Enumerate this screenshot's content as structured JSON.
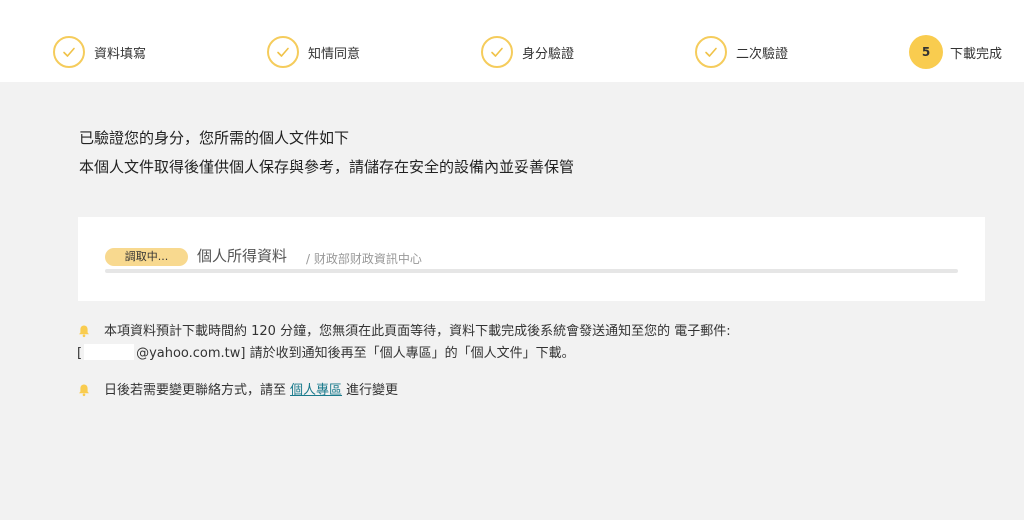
{
  "steps": [
    {
      "label": "資料填寫",
      "status": "done"
    },
    {
      "label": "知情同意",
      "status": "done"
    },
    {
      "label": "身分驗證",
      "status": "done"
    },
    {
      "label": "二次驗證",
      "status": "done"
    },
    {
      "label": "下載完成",
      "status": "active",
      "number": "5"
    }
  ],
  "intro": {
    "line1": "已驗證您的身分，您所需的個人文件如下",
    "line2": "本個人文件取得後僅供個人保存與參考，請儲存在安全的設備內並妥善保管"
  },
  "document": {
    "status_badge": "調取中...",
    "name": "個人所得資料",
    "source": "/ 财政部财政資訊中心",
    "progress": 0
  },
  "notices": {
    "download": {
      "line1": "本項資料預計下載時間約 120 分鐘，您無須在此頁面等待，資料下載完成後系統會發送通知至您的 電子郵件:",
      "bracket_open": "[",
      "email_domain": "@yahoo.com.tw]",
      "line2_rest": "請於收到通知後再至「個人專區」的「個人文件」下載。"
    },
    "contact": {
      "prefix": "日後若需要變更聯絡方式，請至",
      "link": "個人專區",
      "suffix": "進行變更"
    }
  },
  "colors": {
    "accent": "#f9cc4f",
    "accent_border": "#f5cc5c",
    "badge_bg": "#f8d98f",
    "link": "#1a7a8c",
    "page_bg": "#f2f2f2"
  },
  "icons": {
    "done_step": "check-icon",
    "notice": "bell-icon"
  }
}
